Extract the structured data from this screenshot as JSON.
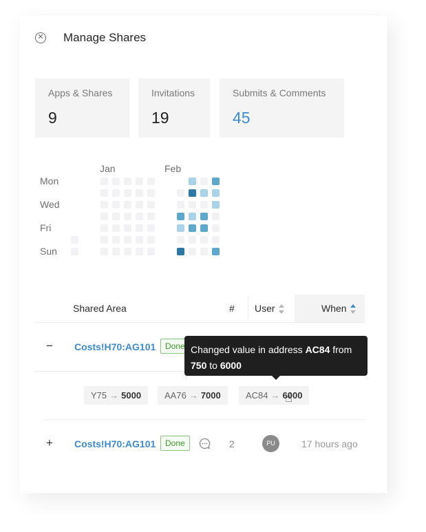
{
  "header": {
    "title": "Manage Shares"
  },
  "stats": [
    {
      "label": "Apps & Shares",
      "value": "9"
    },
    {
      "label": "Invitations",
      "value": "19"
    },
    {
      "label": "Submits & Comments",
      "value": "45"
    }
  ],
  "heatmap": {
    "months": [
      "Jan",
      "Feb"
    ],
    "days": [
      "Mon",
      "Wed",
      "Fri",
      "Sun"
    ],
    "colors": {
      "empty": "#f2f2f4",
      "light": "#a9d3e8",
      "medium": "#5ea8ce",
      "dark": "#2e78a8"
    }
  },
  "table": {
    "columns": {
      "area": "Shared Area",
      "count": "#",
      "user": "User",
      "when": "When"
    },
    "rows": [
      {
        "toggle": "−",
        "area": "Costs!H70:AG101",
        "status": "Done",
        "changes": [
          {
            "from": "Y75",
            "to": "5000"
          },
          {
            "from": "AA76",
            "to": "7000"
          },
          {
            "from": "AC84",
            "to": "6000"
          }
        ]
      },
      {
        "toggle": "+",
        "area": "Costs!H70:AG101",
        "status": "Done",
        "comments": "2",
        "user_initials": "PU",
        "when": "17 hours ago"
      }
    ]
  },
  "tooltip": {
    "prefix": "Changed value in address ",
    "address": "AC84",
    "mid": " from",
    "from": "750",
    "to_word": " to ",
    "to": "6000"
  }
}
